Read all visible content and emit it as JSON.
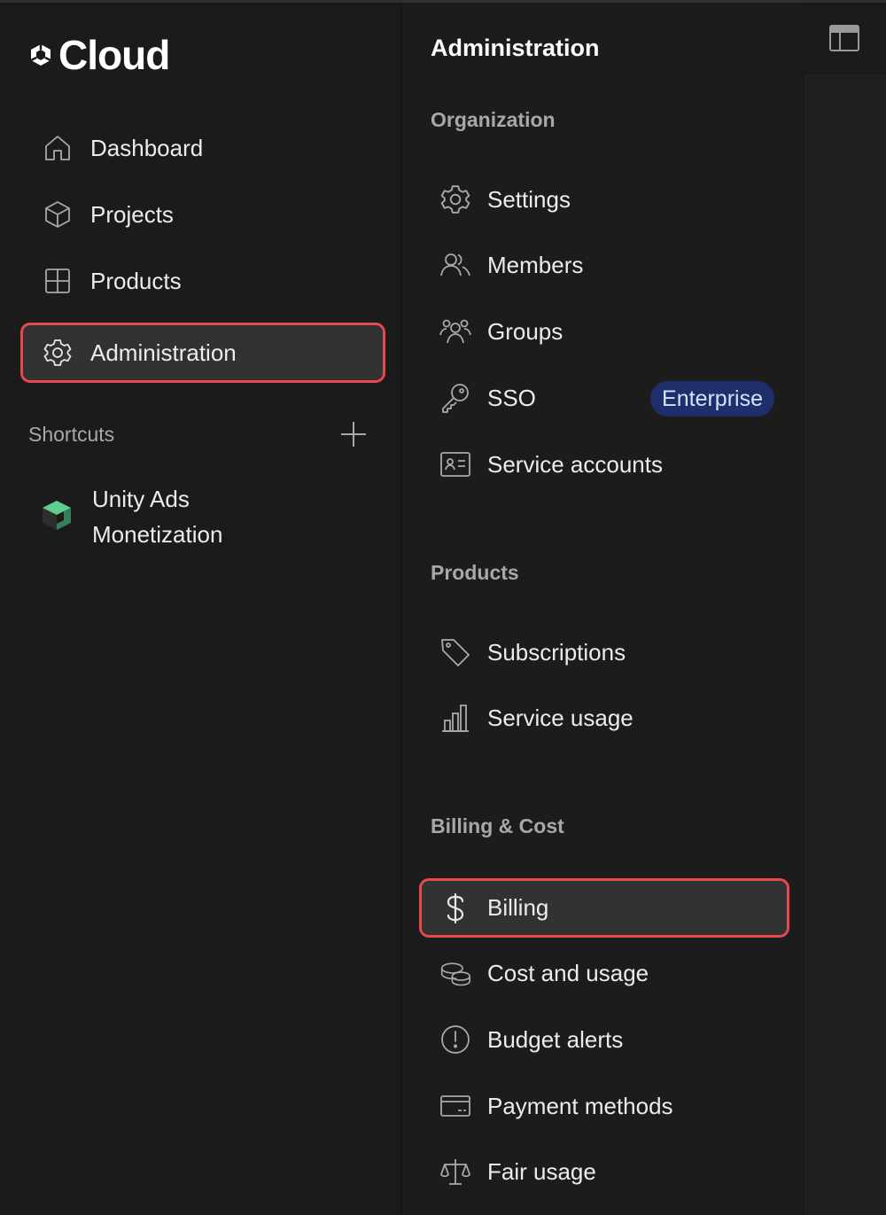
{
  "brand": {
    "name": "Cloud",
    "icon": "unity-logo-icon"
  },
  "nav": {
    "items": [
      {
        "label": "Dashboard",
        "icon": "home-icon"
      },
      {
        "label": "Projects",
        "icon": "cube-icon"
      },
      {
        "label": "Products",
        "icon": "grid-icon"
      },
      {
        "label": "Administration",
        "icon": "gear-icon",
        "active": true
      }
    ]
  },
  "shortcuts": {
    "title": "Shortcuts",
    "add_icon": "plus-icon",
    "items": [
      {
        "label": "Unity Ads Monetization",
        "icon": "unity-ads-icon"
      }
    ]
  },
  "panel": {
    "title": "Administration",
    "sections": [
      {
        "title": "Organization",
        "items": [
          {
            "label": "Settings",
            "icon": "gear-icon"
          },
          {
            "label": "Members",
            "icon": "members-icon"
          },
          {
            "label": "Groups",
            "icon": "groups-icon"
          },
          {
            "label": "SSO",
            "icon": "key-icon",
            "badge": "Enterprise"
          },
          {
            "label": "Service accounts",
            "icon": "id-card-icon"
          }
        ]
      },
      {
        "title": "Products",
        "items": [
          {
            "label": "Subscriptions",
            "icon": "tag-icon"
          },
          {
            "label": "Service usage",
            "icon": "bar-chart-icon"
          }
        ]
      },
      {
        "title": "Billing & Cost",
        "items": [
          {
            "label": "Billing",
            "icon": "dollar-icon",
            "active": true
          },
          {
            "label": "Cost and usage",
            "icon": "coins-icon"
          },
          {
            "label": "Budget alerts",
            "icon": "alert-circle-icon"
          },
          {
            "label": "Payment methods",
            "icon": "credit-card-icon"
          },
          {
            "label": "Fair usage",
            "icon": "scale-icon"
          }
        ]
      }
    ]
  },
  "colors": {
    "highlight": "#e5484d",
    "badge_bg": "#1f2f6b",
    "active_bg": "#323232"
  },
  "layout_toggle_icon": "layout-panel-icon"
}
